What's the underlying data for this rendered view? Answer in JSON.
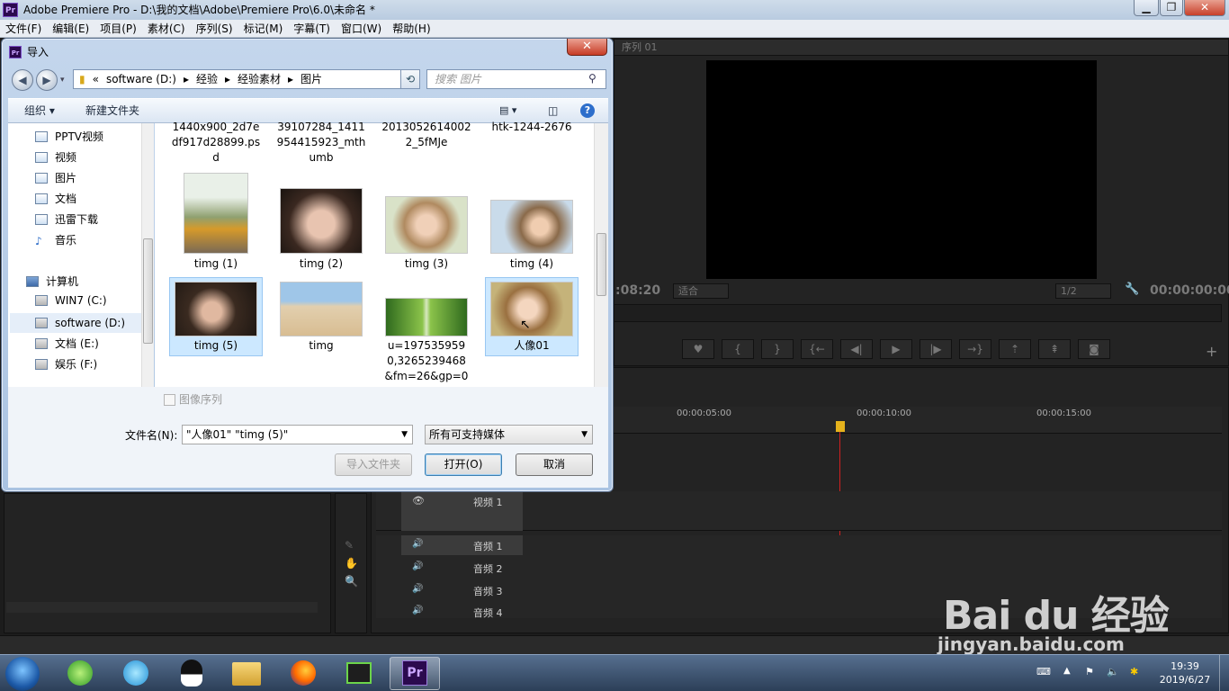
{
  "app": {
    "title": "Adobe Premiere Pro - D:\\我的文档\\Adobe\\Premiere Pro\\6.0\\未命名 *",
    "logo": "Pr",
    "controls": {
      "minimize": "▁",
      "maximize": "❐",
      "close": "✕"
    }
  },
  "menu": [
    "文件(F)",
    "编辑(E)",
    "项目(P)",
    "素材(C)",
    "序列(S)",
    "标记(M)",
    "字幕(T)",
    "窗口(W)",
    "帮助(H)"
  ],
  "premiere": {
    "program_tab": "序列 01",
    "timecode_left": ":08:20",
    "fit": "适合",
    "zoom": "1/2",
    "timecode_right": "00:00:00:00",
    "timeline_ticks": [
      "00:00:05:00",
      "00:00:10:00",
      "00:00:15:00"
    ],
    "video_tracks": [
      {
        "label": "视频 1"
      }
    ],
    "audio_tracks": [
      {
        "label": "音频 1"
      },
      {
        "label": "音频 2"
      },
      {
        "label": "音频 3"
      },
      {
        "label": "音频 4"
      }
    ]
  },
  "dialog": {
    "title": "导入",
    "close_label": "✕",
    "address": {
      "prefix": "«",
      "crumbs": [
        "software (D:)",
        "经验",
        "经验素材",
        "图片"
      ]
    },
    "search_placeholder": "搜索 图片",
    "toolbar": {
      "organize": "组织 ▾",
      "new_folder": "新建文件夹"
    },
    "nav": {
      "favorites": [
        "PPTV视频",
        "视频",
        "图片",
        "文档",
        "迅雷下载",
        "音乐"
      ],
      "computer": "计算机",
      "drives": [
        "WIN7 (C:)",
        "software (D:)",
        "文档 (E:)",
        "娱乐 (F:)"
      ]
    },
    "partial_files": [
      "1440x900_2d7e df917d28899.ps d",
      "39107284_1411 954415923_mth umb",
      "2013052614002 2_5fMJe",
      "htk-1244-2676"
    ],
    "files": [
      {
        "name": "timg (1)",
        "selected": false
      },
      {
        "name": "timg (2)",
        "selected": false
      },
      {
        "name": "timg (3)",
        "selected": false
      },
      {
        "name": "timg (4)",
        "selected": false
      },
      {
        "name": "timg (5)",
        "selected": true
      },
      {
        "name": "timg",
        "selected": false
      },
      {
        "name": "u=1975359590,3265239468&fm=26&gp=0",
        "selected": false
      },
      {
        "name": "人像01",
        "selected": true
      }
    ],
    "image_sequence_label": "图像序列",
    "filename_label": "文件名(N):",
    "filename_value": "\"人像01\" \"timg (5)\"",
    "filetype": "所有可支持媒体",
    "import_folder": "导入文件夹",
    "open": "打开(O)",
    "cancel": "取消"
  },
  "taskbar": {
    "time": "19:39",
    "date": "2019/6/27"
  },
  "watermark": {
    "brand": "Bai du 经验",
    "url": "jingyan.baidu.com"
  }
}
